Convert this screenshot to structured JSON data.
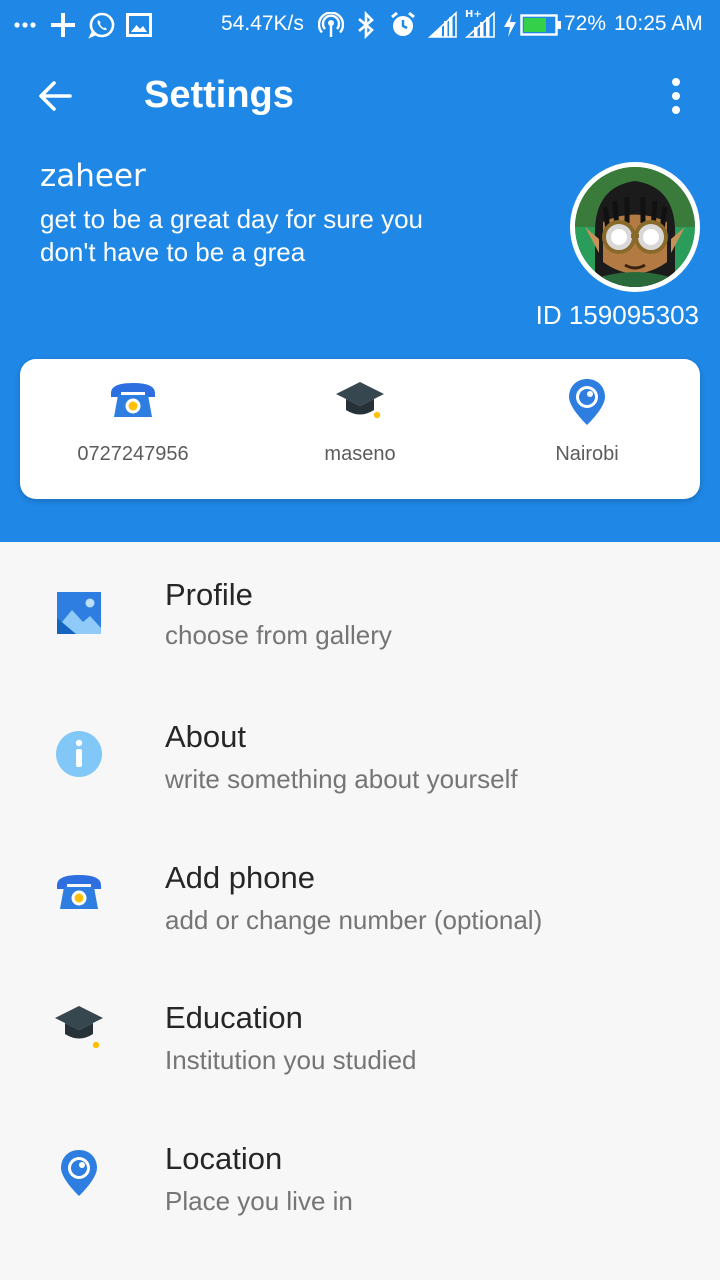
{
  "status_bar": {
    "net_speed": "54.47K/s",
    "battery": "72%",
    "time": "10:25 AM"
  },
  "toolbar": {
    "title": "Settings"
  },
  "profile": {
    "username": "zaheer",
    "bio": "get to be a great day for sure you don't have to be a grea",
    "id_text": "ID 159095303"
  },
  "info_card": {
    "items": [
      {
        "icon": "phone-icon",
        "label": "0727247956"
      },
      {
        "icon": "graduation-cap-icon",
        "label": "maseno"
      },
      {
        "icon": "location-pin-icon",
        "label": "Nairobi"
      }
    ]
  },
  "settings": [
    {
      "icon": "gallery-icon",
      "title": "Profile",
      "subtitle": "choose from gallery"
    },
    {
      "icon": "info-icon",
      "title": "About",
      "subtitle": "write something about yourself"
    },
    {
      "icon": "phone-icon",
      "title": "Add phone",
      "subtitle": "add or change number (optional)"
    },
    {
      "icon": "graduation-cap-icon",
      "title": "Education",
      "subtitle": "Institution you studied"
    },
    {
      "icon": "location-pin-icon",
      "title": "Location",
      "subtitle": "Place you live in"
    }
  ],
  "colors": {
    "header_blue": "#1f87e5",
    "icon_blue": "#2d7ee0",
    "icon_yellow": "#ffc107",
    "icon_dark": "#37474f",
    "info_light_blue": "#81c7f7"
  }
}
